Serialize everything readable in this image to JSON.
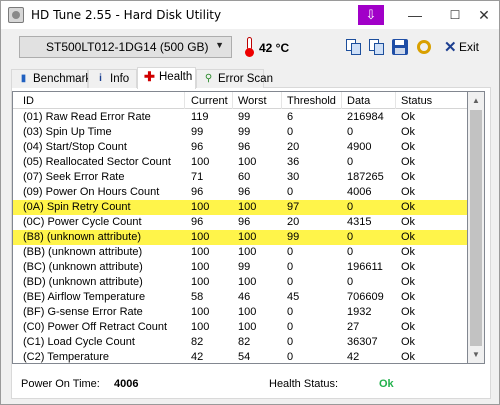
{
  "window": {
    "title": "HD Tune 2.55 - Hard Disk Utility",
    "titlebar_buttons": {
      "download": "⇩",
      "minimize": "—",
      "maximize": "☐",
      "close": "✕"
    }
  },
  "toolbar": {
    "drive": "ST500LT012-1DG14 (500 GB)",
    "temperature": "42 °C",
    "exit_label": "Exit",
    "exit_icon": "✕"
  },
  "tabs": [
    {
      "label": "Benchmark",
      "icon": "chart-icon"
    },
    {
      "label": "Info",
      "icon": "info-icon"
    },
    {
      "label": "Health",
      "icon": "health-cross-icon"
    },
    {
      "label": "Error Scan",
      "icon": "magnifier-icon"
    }
  ],
  "table": {
    "columns": [
      "ID",
      "Current",
      "Worst",
      "Threshold",
      "Data",
      "Status"
    ],
    "rows": [
      [
        "(01) Raw Read Error Rate",
        "119",
        "99",
        "6",
        "216984",
        "Ok"
      ],
      [
        "(03) Spin Up Time",
        "99",
        "99",
        "0",
        "0",
        "Ok"
      ],
      [
        "(04) Start/Stop Count",
        "96",
        "96",
        "20",
        "4900",
        "Ok"
      ],
      [
        "(05) Reallocated Sector Count",
        "100",
        "100",
        "36",
        "0",
        "Ok"
      ],
      [
        "(07) Seek Error Rate",
        "71",
        "60",
        "30",
        "187265",
        "Ok"
      ],
      [
        "(09) Power On Hours Count",
        "96",
        "96",
        "0",
        "4006",
        "Ok"
      ],
      [
        "(0A) Spin Retry Count",
        "100",
        "100",
        "97",
        "0",
        "Ok"
      ],
      [
        "(0C) Power Cycle Count",
        "96",
        "96",
        "20",
        "4315",
        "Ok"
      ],
      [
        "(B8) (unknown attribute)",
        "100",
        "100",
        "99",
        "0",
        "Ok"
      ],
      [
        "(BB) (unknown attribute)",
        "100",
        "100",
        "0",
        "0",
        "Ok"
      ],
      [
        "(BC) (unknown attribute)",
        "100",
        "99",
        "0",
        "196611",
        "Ok"
      ],
      [
        "(BD) (unknown attribute)",
        "100",
        "100",
        "0",
        "0",
        "Ok"
      ],
      [
        "(BE) Airflow Temperature",
        "58",
        "46",
        "45",
        "706609",
        "Ok"
      ],
      [
        "(BF) G-sense Error Rate",
        "100",
        "100",
        "0",
        "1932",
        "Ok"
      ],
      [
        "(C0) Power Off Retract Count",
        "100",
        "100",
        "0",
        "27",
        "Ok"
      ],
      [
        "(C1) Load Cycle Count",
        "82",
        "82",
        "0",
        "36307",
        "Ok"
      ],
      [
        "(C2) Temperature",
        "42",
        "54",
        "0",
        "42",
        "Ok"
      ]
    ],
    "highlighted_rows": [
      6,
      8
    ],
    "highlight_color": "#fff44a"
  },
  "footer": {
    "power_on_label": "Power On Time:",
    "power_on_value": "4006",
    "health_label": "Health Status:",
    "health_value": "Ok",
    "health_color": "#22b14c"
  }
}
